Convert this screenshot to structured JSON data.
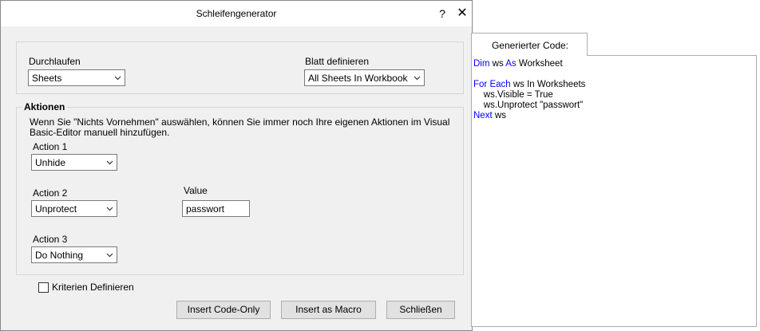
{
  "window": {
    "title": "Schleifengenerator",
    "help_label": "?",
    "close_label": "✕"
  },
  "loop": {
    "label": "Durchlaufen",
    "value": "Sheets"
  },
  "sheet": {
    "label": "Blatt definieren",
    "value": "All Sheets In Workbook"
  },
  "actions": {
    "group_label": "Aktionen",
    "description_line1": "Wenn Sie \"Nichts Vornehmen\" auswählen, können Sie immer noch Ihre eigenen Aktionen im Visual",
    "description_line2": "Basic-Editor manuell hinzufügen.",
    "action1": {
      "label": "Action 1",
      "value": "Unhide"
    },
    "action2": {
      "label": "Action 2",
      "value": "Unprotect"
    },
    "action3": {
      "label": "Action 3",
      "value": "Do Nothing"
    },
    "value_field": {
      "label": "Value",
      "value": "passwort"
    }
  },
  "criteria": {
    "label": "Kriterien Definieren",
    "checked": false
  },
  "buttons": {
    "insert_code_only": "Insert Code-Only",
    "insert_macro": "Insert as Macro",
    "close": "Schließen"
  },
  "code": {
    "tab_label": "Generierter Code:",
    "line1_kw1": "Dim",
    "line1_mid": " ws ",
    "line1_kw2": "As",
    "line1_end": " Worksheet",
    "line2_kw": "For Each",
    "line2_rest": " ws In Worksheets",
    "line3": "    ws.Visible = True",
    "line4": "    ws.Unprotect \"passwort\"",
    "line5_kw": "Next",
    "line5_rest": " ws",
    "keyword_color": "#0000ff"
  }
}
